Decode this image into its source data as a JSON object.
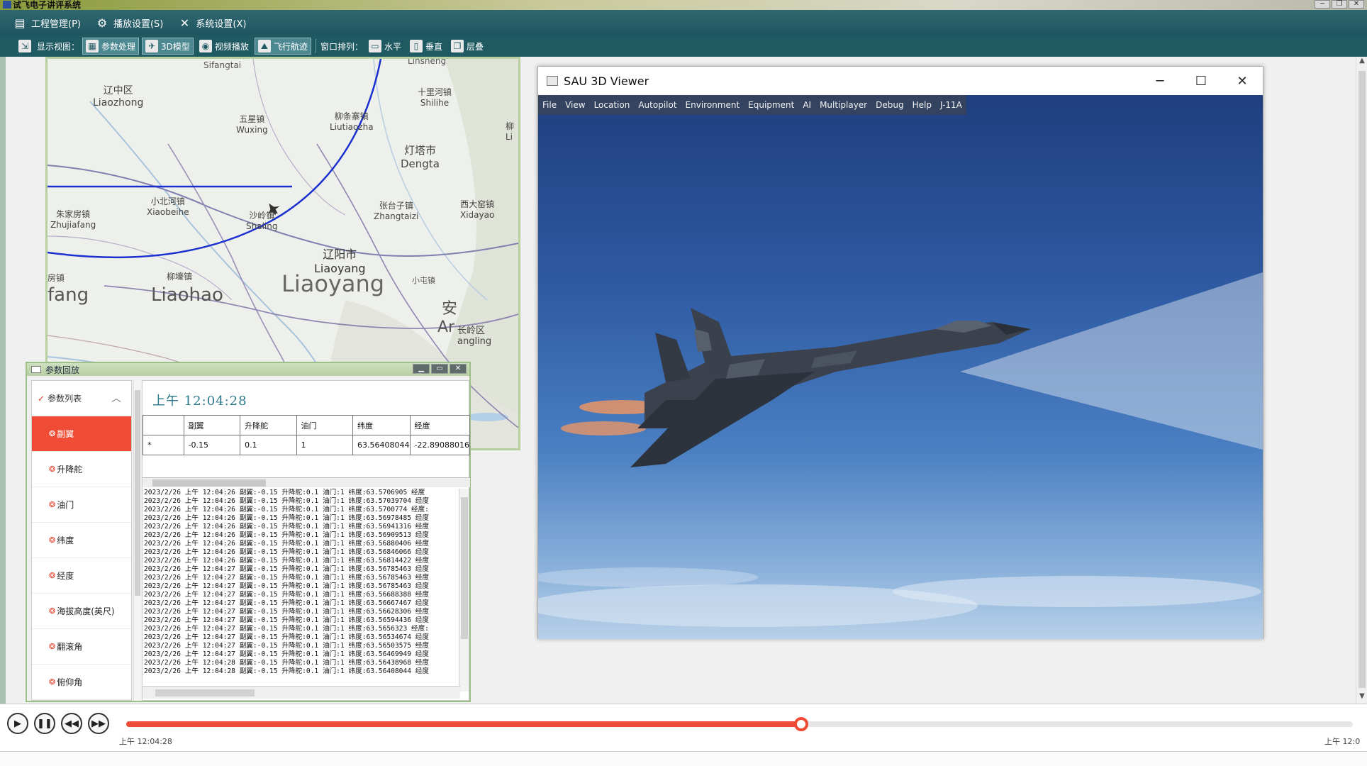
{
  "app": {
    "title": "试飞电子讲评系统",
    "window_controls": [
      "─",
      "❐",
      "✕"
    ]
  },
  "menu": {
    "items": [
      {
        "label": "工程管理(P)",
        "icon": "project-icon"
      },
      {
        "label": "播放设置(S)",
        "icon": "gear-icon"
      },
      {
        "label": "系统设置(X)",
        "icon": "tools-icon"
      }
    ]
  },
  "toolbar": {
    "view_label": "显示视图：",
    "views": [
      {
        "label": "参数处理",
        "icon": "table-icon",
        "active": true
      },
      {
        "label": "3D模型",
        "icon": "plane-icon",
        "active": true
      },
      {
        "label": "视频播放",
        "icon": "video-icon",
        "active": false
      },
      {
        "label": "飞行航迹",
        "icon": "map-icon",
        "active": true
      }
    ],
    "arrange_label": "窗口排列：",
    "arrange": [
      {
        "label": "水平",
        "icon": "horizontal-icon"
      },
      {
        "label": "垂直",
        "icon": "vertical-icon"
      },
      {
        "label": "层叠",
        "icon": "cascade-icon"
      }
    ]
  },
  "map": {
    "labels": [
      {
        "cn": "Sifangtai",
        "en": ""
      },
      {
        "cn": "Linsheng",
        "en": ""
      },
      {
        "cn": "辽中区",
        "en": "Liaozhong"
      },
      {
        "cn": "五星镇",
        "en": "Wuxing"
      },
      {
        "cn": "柳条寨镇",
        "en": "Liutiaozha"
      },
      {
        "cn": "十里河镇",
        "en": "Shilihe"
      },
      {
        "cn": "灯塔市",
        "en": "Dengta"
      },
      {
        "cn": "小北河镇",
        "en": "Xiaobeihe"
      },
      {
        "cn": "张台子镇",
        "en": "Zhangtaizi"
      },
      {
        "cn": "西大窑镇",
        "en": "Xidayao"
      },
      {
        "cn": "朱家房镇",
        "en": "Zhujiafang"
      },
      {
        "cn": "沙岭镇",
        "en": "Shaling"
      },
      {
        "cn": "辽阳市",
        "en": "Liaoyang"
      },
      {
        "cn": "柳壕镇",
        "en": ""
      },
      {
        "cn": "Liaohao",
        "en": ""
      },
      {
        "cn": "Liaoyang",
        "en": ""
      },
      {
        "cn": "fang",
        "en": ""
      },
      {
        "cn": "安",
        "en": ""
      },
      {
        "cn": "Ar",
        "en": ""
      },
      {
        "cn": "长岭区",
        "en": "angling"
      },
      {
        "cn": "柳",
        "en": "Li"
      },
      {
        "cn": "房镇",
        "en": ""
      },
      {
        "cn": "小屯镇",
        "en": ""
      }
    ],
    "track_color": "#1a2fd0"
  },
  "viewer": {
    "title": "SAU 3D Viewer",
    "controls": [
      "─",
      "☐",
      "✕"
    ],
    "menu": [
      "File",
      "View",
      "Location",
      "Autopilot",
      "Environment",
      "Equipment",
      "AI",
      "Multiplayer",
      "Debug",
      "Help",
      "J-11A"
    ]
  },
  "params": {
    "title": "参数回放",
    "controls": [
      "▁",
      "▭",
      "✕"
    ],
    "list_header": "参数列表",
    "list_items": [
      {
        "label": "副翼",
        "selected": true
      },
      {
        "label": "升降舵",
        "selected": false
      },
      {
        "label": "油门",
        "selected": false
      },
      {
        "label": "纬度",
        "selected": false
      },
      {
        "label": "经度",
        "selected": false
      },
      {
        "label": "海拔高度(英尺)",
        "selected": false
      },
      {
        "label": "翻滚角",
        "selected": false
      },
      {
        "label": "俯仰角",
        "selected": false
      }
    ],
    "time": "上午 12:04:28",
    "table": {
      "headers": [
        "",
        "副翼",
        "升降舵",
        "油门",
        "纬度",
        "经度"
      ],
      "row": [
        "*",
        "-0.15",
        "0.1",
        "1",
        "63.56408044",
        "-22.89088016"
      ]
    },
    "log_lines": [
      "2023/2/26 上午 12:04:26 副翼:-0.15 升降舵:0.1 油门:1 纬度:63.5706905 经度",
      "2023/2/26 上午 12:04:26 副翼:-0.15 升降舵:0.1 油门:1 纬度:63.57039704 经度",
      "2023/2/26 上午 12:04:26 副翼:-0.15 升降舵:0.1 油门:1 纬度:63.5700774 经度:",
      "2023/2/26 上午 12:04:26 副翼:-0.15 升降舵:0.1 油门:1 纬度:63.56978485 经度",
      "2023/2/26 上午 12:04:26 副翼:-0.15 升降舵:0.1 油门:1 纬度:63.56941316 经度",
      "2023/2/26 上午 12:04:26 副翼:-0.15 升降舵:0.1 油门:1 纬度:63.56909513 经度",
      "2023/2/26 上午 12:04:26 副翼:-0.15 升降舵:0.1 油门:1 纬度:63.56880406 经度",
      "2023/2/26 上午 12:04:26 副翼:-0.15 升降舵:0.1 油门:1 纬度:63.56846066 经度",
      "2023/2/26 上午 12:04:26 副翼:-0.15 升降舵:0.1 油门:1 纬度:63.56814422 经度",
      "2023/2/26 上午 12:04:27 副翼:-0.15 升降舵:0.1 油门:1 纬度:63.56785463 经度",
      "2023/2/26 上午 12:04:27 副翼:-0.15 升降舵:0.1 油门:1 纬度:63.56785463 经度",
      "2023/2/26 上午 12:04:27 副翼:-0.15 升降舵:0.1 油门:1 纬度:63.56785463 经度",
      "2023/2/26 上午 12:04:27 副翼:-0.15 升降舵:0.1 油门:1 纬度:63.56688388 经度",
      "2023/2/26 上午 12:04:27 副翼:-0.15 升降舵:0.1 油门:1 纬度:63.56667467 经度",
      "2023/2/26 上午 12:04:27 副翼:-0.15 升降舵:0.1 油门:1 纬度:63.56628306 经度",
      "2023/2/26 上午 12:04:27 副翼:-0.15 升降舵:0.1 油门:1 纬度:63.56594436 经度",
      "2023/2/26 上午 12:04:27 副翼:-0.15 升降舵:0.1 油门:1 纬度:63.5656323 经度:",
      "2023/2/26 上午 12:04:27 副翼:-0.15 升降舵:0.1 油门:1 纬度:63.56534674 经度",
      "2023/2/26 上午 12:04:27 副翼:-0.15 升降舵:0.1 油门:1 纬度:63.56503575 经度",
      "2023/2/26 上午 12:04:27 副翼:-0.15 升降舵:0.1 油门:1 纬度:63.56469949 经度",
      "2023/2/26 上午 12:04:28 副翼:-0.15 升降舵:0.1 油门:1 纬度:63.56438968 经度",
      "2023/2/26 上午 12:04:28 副翼:-0.15 升降舵:0.1 油门:1 纬度:63.56408044 经度"
    ]
  },
  "playback": {
    "buttons": [
      {
        "name": "play-button",
        "glyph": "▶"
      },
      {
        "name": "pause-button",
        "glyph": "❚❚"
      },
      {
        "name": "rewind-button",
        "glyph": "◀◀"
      },
      {
        "name": "forward-button",
        "glyph": "▶▶"
      }
    ],
    "progress": 0.55,
    "start_time": "上午 12:04:28",
    "end_time": "上午 12:0",
    "accent": "#ef4b35"
  }
}
